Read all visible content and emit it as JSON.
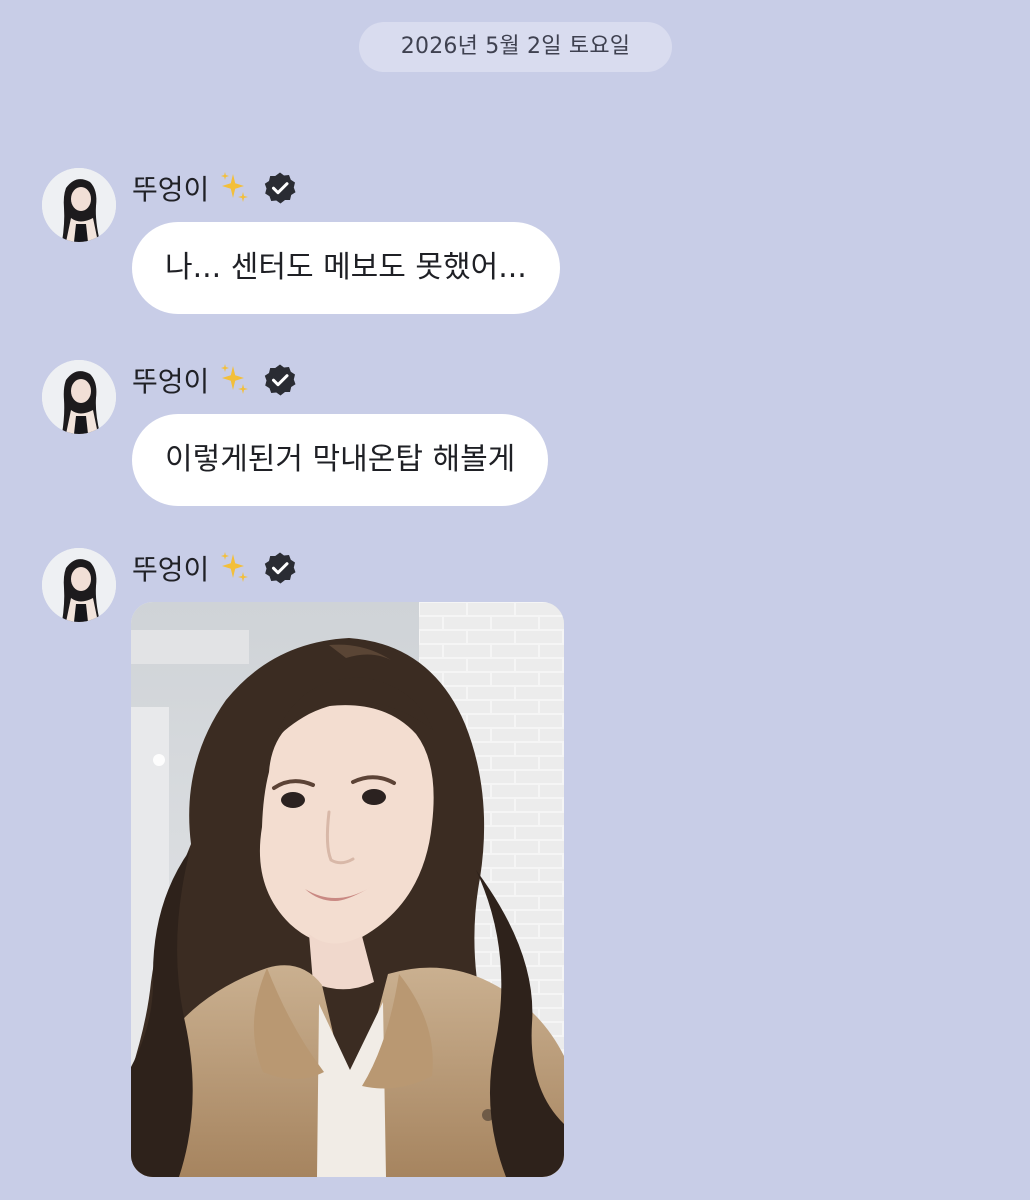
{
  "date_divider": "2026년 5월 2일 토요일",
  "messages": [
    {
      "sender": "뚜엉이",
      "text": "나... 센터도 메보도 못했어..."
    },
    {
      "sender": "뚜엉이",
      "text": "이렇게된거 막내온탑 해볼게"
    },
    {
      "sender": "뚜엉이",
      "type": "photo"
    }
  ],
  "icons": {
    "sender_badge": "sparkles-icon",
    "verified": "verified-badge-icon"
  },
  "colors": {
    "background": "#c8cde7",
    "date_pill": "#d9dcef",
    "bubble": "#ffffff",
    "text": "#1f2025",
    "verified": "#2a2c33",
    "sparkle": "#f3bf3a"
  }
}
